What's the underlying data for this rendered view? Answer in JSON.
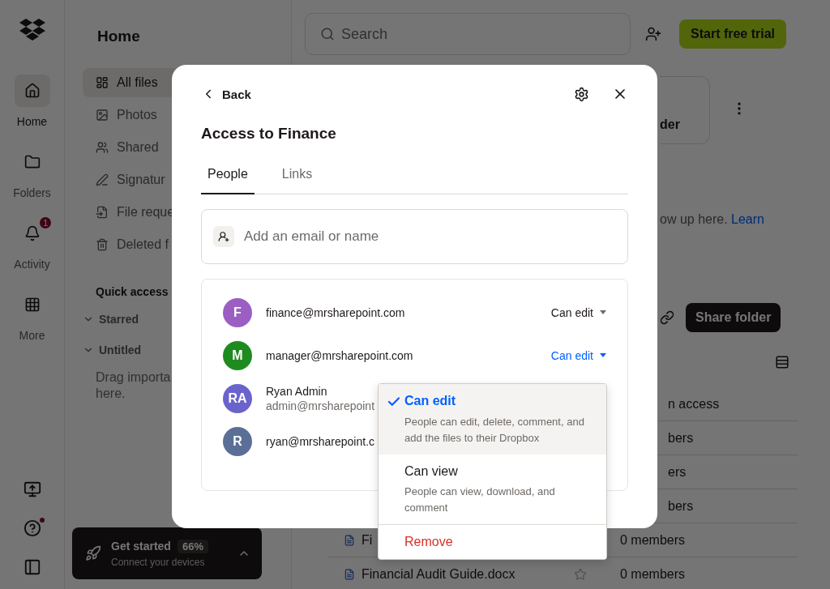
{
  "nav_rail": {
    "items": [
      {
        "label": "Home",
        "selected": true
      },
      {
        "label": "Folders",
        "selected": false
      },
      {
        "label": "Activity",
        "selected": false,
        "badge": "1"
      },
      {
        "label": "More",
        "selected": false
      }
    ]
  },
  "sidebar": {
    "title": "Home",
    "items": [
      {
        "label": "All files",
        "selected": true
      },
      {
        "label": "Photos",
        "selected": false
      },
      {
        "label": "Shared",
        "selected": false
      },
      {
        "label": "Signatur",
        "selected": false
      },
      {
        "label": "File reque",
        "selected": false
      },
      {
        "label": "Deleted f",
        "selected": false
      }
    ],
    "quick_access": {
      "title": "Quick access",
      "sections": [
        {
          "label": "Starred",
          "expanded": true
        },
        {
          "label": "Untitled",
          "expanded": true,
          "hint_lines": [
            "Drag importa",
            "here."
          ]
        }
      ]
    },
    "get_started": {
      "title": "Get started",
      "percent": "66%",
      "subtitle": "Connect your devices"
    }
  },
  "top_bar": {
    "search": {
      "placeholder": "Search"
    },
    "trial_button": "Start free trial"
  },
  "content": {
    "card_label": "der",
    "info_text": "ow up here.",
    "info_link": "Learn",
    "share_button": "Share folder",
    "rows": [
      {
        "members": "n access"
      },
      {
        "members": "bers"
      },
      {
        "members": "ers"
      },
      {
        "members": "bers"
      },
      {
        "file": "Fi",
        "members": "0 members"
      },
      {
        "file": "Financial Audit Guide.docx",
        "members": "0 members"
      }
    ]
  },
  "modal": {
    "back": "Back",
    "title": "Access to Finance",
    "tabs": [
      {
        "label": "People",
        "selected": true
      },
      {
        "label": "Links",
        "selected": false
      }
    ],
    "invite": {
      "placeholder": "Add an email or name"
    },
    "members": [
      {
        "initials": "F",
        "color": "#9b5fc4",
        "primary": "finance@mrsharepoint.com",
        "role": "Can edit",
        "menu_open": false
      },
      {
        "initials": "M",
        "color": "#1f8a1f",
        "primary": "manager@mrsharepoint.com",
        "role": "Can edit",
        "menu_open": true
      },
      {
        "initials": "RA",
        "color": "#6b63cc",
        "primary": "Ryan Admin",
        "secondary": "admin@mrsharepoint"
      },
      {
        "initials": "R",
        "color": "#5b6f96",
        "primary": "ryan@mrsharepoint.c"
      }
    ]
  },
  "role_menu": {
    "options": [
      {
        "label": "Can edit",
        "description": "People can edit, delete, comment, and add the files to their Dropbox",
        "selected": true
      },
      {
        "label": "Can view",
        "description": "People can view, download, and comment",
        "selected": false
      }
    ],
    "remove": "Remove"
  }
}
